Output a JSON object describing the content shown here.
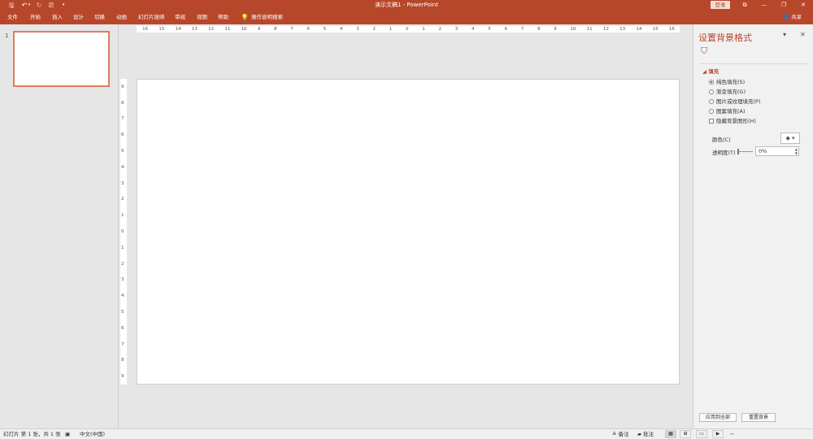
{
  "window": {
    "title": "演示文稿1 - PowerPoint",
    "login_label": "登录",
    "controls": {
      "ribbon_opts": "⧉",
      "minimize": "—",
      "restore": "❐",
      "close": "✕"
    }
  },
  "quick_access": {
    "save": "🖫",
    "undo": "↶",
    "undo_menu": "▾",
    "redo": "↻",
    "present": "⎚",
    "customize": "▾"
  },
  "menu": {
    "items": [
      "文件",
      "开始",
      "插入",
      "设计",
      "切换",
      "动画",
      "幻灯片放映",
      "审阅",
      "视图",
      "帮助"
    ],
    "search": "操作说明搜索",
    "share": "共享"
  },
  "thumbnails": {
    "slide_number": "1"
  },
  "ruler": {
    "horizontal": [
      "16",
      "15",
      "14",
      "13",
      "12",
      "11",
      "10",
      "9",
      "8",
      "7",
      "6",
      "5",
      "4",
      "3",
      "2",
      "1",
      "0",
      "1",
      "2",
      "3",
      "4",
      "5",
      "6",
      "7",
      "8",
      "9",
      "10",
      "11",
      "12",
      "13",
      "14",
      "15",
      "16"
    ],
    "vertical": [
      "9",
      "8",
      "7",
      "6",
      "5",
      "4",
      "3",
      "2",
      "1",
      "0",
      "1",
      "2",
      "3",
      "4",
      "5",
      "6",
      "7",
      "8",
      "9"
    ]
  },
  "format_pane": {
    "title": "设置背景格式",
    "dropdown": "▾",
    "close": "✕",
    "section": "填充",
    "options": [
      {
        "label": "纯色填充(S)",
        "checked": true
      },
      {
        "label": "渐变填充(G)",
        "checked": false
      },
      {
        "label": "图片或纹理填充(P)",
        "checked": false
      },
      {
        "label": "图案填充(A)",
        "checked": false
      }
    ],
    "hide_bg": "隐藏背景图形(H)",
    "color_label": "颜色(C)",
    "color_btn": "◆ ▾",
    "transparency_label": "透明度(T)",
    "transparency_value": "0%",
    "apply_all": "应用到全部",
    "reset": "重置背景"
  },
  "status": {
    "slide_info": "幻灯片 第 1 张，共 1 张",
    "language": "中文(中国)",
    "notes": "备注",
    "comments": "批注",
    "minus": "−"
  },
  "colors": {
    "accent": "#b7472a",
    "thumb_border": "#e07b5f"
  }
}
